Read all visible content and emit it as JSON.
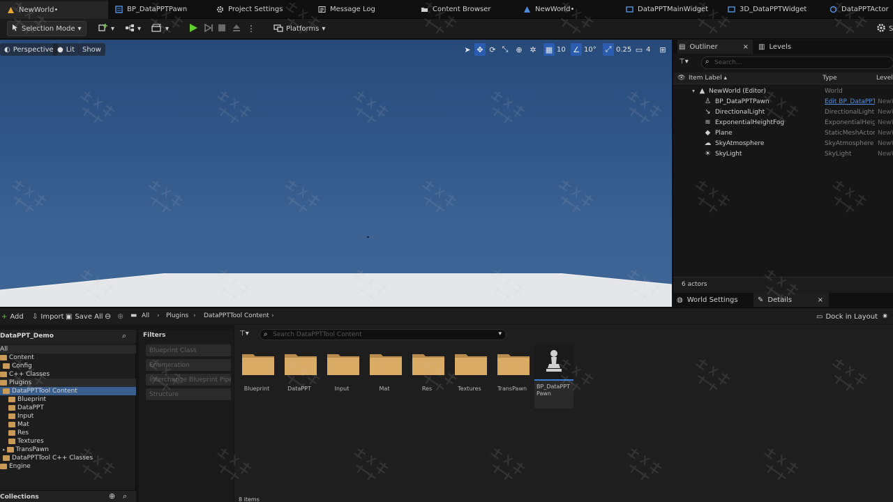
{
  "tabs": [
    {
      "label": "NewWorld•",
      "active": true
    },
    {
      "label": "BP_DataPPTPawn"
    },
    {
      "label": "Project Settings"
    },
    {
      "label": "Message Log"
    },
    {
      "label": "Content Browser"
    },
    {
      "label": "NewWorld•"
    },
    {
      "label": "DataPPTMainWidget"
    },
    {
      "label": "3D_DataPPTWidget"
    },
    {
      "label": "DataPPTActor"
    }
  ],
  "toolbar": {
    "selection_mode": "Selection Mode",
    "platforms": "Platforms",
    "settings_partial": "S"
  },
  "viewport": {
    "perspective": "Perspective",
    "lit": "Lit",
    "show": "Show",
    "grid_snap": "10",
    "rotation_snap": "10°",
    "scale_snap": "0.25",
    "camera_speed": "4"
  },
  "outliner": {
    "tab_outliner": "Outliner",
    "tab_levels": "Levels",
    "search_placeholder": "Search...",
    "col_label": "Item Label ▴",
    "col_type": "Type",
    "col_level": "Level",
    "rows": [
      {
        "label": "NewWorld (Editor)",
        "type": "World",
        "level": "",
        "icon": "world-icon"
      },
      {
        "label": "BP_DataPPTPawn",
        "type": "Edit BP_DataPPTPawn",
        "level": "NewW",
        "icon": "pawn-icon"
      },
      {
        "label": "DirectionalLight",
        "type": "DirectionalLight",
        "level": "NewW",
        "icon": "light-icon"
      },
      {
        "label": "ExponentialHeightFog",
        "type": "ExponentialHeightFog",
        "level": "NewW",
        "icon": "fog-icon"
      },
      {
        "label": "Plane",
        "type": "StaticMeshActor",
        "level": "NewW",
        "icon": "mesh-icon"
      },
      {
        "label": "SkyAtmosphere",
        "type": "SkyAtmosphere",
        "level": "NewW",
        "icon": "atmosphere-icon"
      },
      {
        "label": "SkyLight",
        "type": "SkyLight",
        "level": "NewW",
        "icon": "skylight-icon"
      }
    ],
    "actor_count": "6 actors"
  },
  "details": {
    "world_settings": "World Settings",
    "details": "Details"
  },
  "content_browser": {
    "add": "Add",
    "import": "Import",
    "save_all": "Save All",
    "path": [
      "All",
      "Plugins",
      "DataPPTTool Content"
    ],
    "dock_in_layout": "Dock in Layout",
    "project_name": "DataPPT_Demo",
    "tree": [
      {
        "label": "All",
        "indent": 0,
        "folder": false
      },
      {
        "label": "Content",
        "indent": 0,
        "folder": true
      },
      {
        "label": "Config",
        "indent": 1,
        "folder": true
      },
      {
        "label": "C++ Classes",
        "indent": 0,
        "folder": true
      },
      {
        "label": "Plugins",
        "indent": 0,
        "folder": true
      },
      {
        "label": "DataPPTTool Content",
        "indent": 1,
        "folder": true,
        "selected": true
      },
      {
        "label": "Blueprint",
        "indent": 2,
        "folder": true
      },
      {
        "label": "DataPPT",
        "indent": 2,
        "folder": true
      },
      {
        "label": "Input",
        "indent": 2,
        "folder": true
      },
      {
        "label": "Mat",
        "indent": 2,
        "folder": true
      },
      {
        "label": "Res",
        "indent": 2,
        "folder": true
      },
      {
        "label": "Textures",
        "indent": 2,
        "folder": true
      },
      {
        "label": "TransPawn",
        "indent": 2,
        "folder": true
      },
      {
        "label": "DataPPTTool C++ Classes",
        "indent": 1,
        "folder": true
      },
      {
        "label": "Engine",
        "indent": 0,
        "folder": true
      }
    ],
    "collections": "Collections",
    "filters_title": "Filters",
    "filters": [
      "Blueprint Class",
      "Enumeration",
      "Interchange Blueprint Pipeline",
      "Structure"
    ],
    "search_placeholder": "Search DataPPTTool Content",
    "assets": [
      "Blueprint",
      "DataPPT",
      "Input",
      "Mat",
      "Res",
      "Textures",
      "TransPawn"
    ],
    "pawn_asset": "BP_DataPPTPawn",
    "item_count": "8 items"
  }
}
